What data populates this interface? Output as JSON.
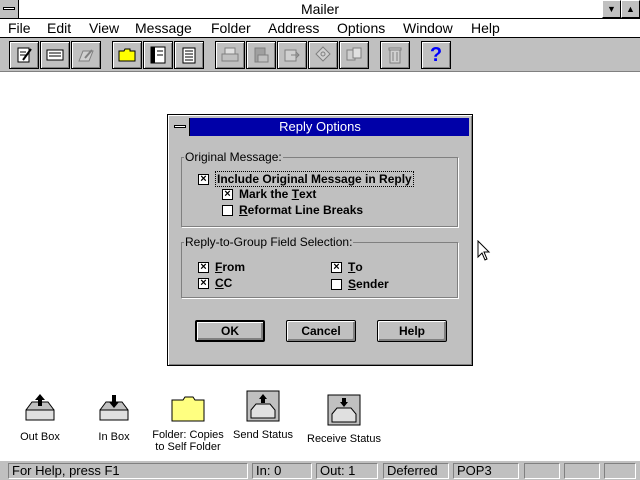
{
  "window": {
    "title": "Mailer",
    "min_glyph": "▼",
    "max_glyph": "▲"
  },
  "menu": [
    "File",
    "Edit",
    "View",
    "Message",
    "Folder",
    "Address",
    "Options",
    "Window",
    "Help"
  ],
  "toolbar": {
    "buttons": [
      "compose-icon",
      "reply-icon",
      "forward-icon",
      "open-folder-icon",
      "address-book-icon",
      "notepad-icon",
      "print-icon",
      "print-setup-icon",
      "move-icon",
      "attach-icon",
      "copy-icon",
      "delete-icon",
      "help-icon"
    ],
    "help_glyph": "?"
  },
  "dialog": {
    "title": "Reply Options",
    "original_group": "Original Message:",
    "include_original": {
      "label": "Include Original Message in Reply",
      "checked": true
    },
    "mark_text": {
      "label_pre": "Mark the ",
      "label_u": "T",
      "label_post": "ext",
      "checked": true
    },
    "reformat": {
      "label_u": "R",
      "label_post": "eformat Line Breaks",
      "checked": false
    },
    "group_field": "Reply-to-Group Field Selection:",
    "from": {
      "label_u": "F",
      "label_post": "rom",
      "checked": true
    },
    "to": {
      "label_u": "T",
      "label_post": "o",
      "checked": true
    },
    "cc": {
      "label_u": "C",
      "label_post": "C",
      "checked": true
    },
    "sender": {
      "label_u": "S",
      "label_post": "ender",
      "checked": false
    },
    "ok": "OK",
    "cancel": "Cancel",
    "help": "Help",
    "check_glyph": "×"
  },
  "desktop_icons": [
    {
      "label": "Out Box"
    },
    {
      "label": "In Box"
    },
    {
      "label1": "Folder: Copies",
      "label2": "to Self Folder"
    },
    {
      "label": "Send Status"
    },
    {
      "label": "Receive Status"
    }
  ],
  "status": {
    "help": "For Help, press F1",
    "in": "In:  0",
    "out": "Out:  1",
    "deferred": "Deferred",
    "protocol": "POP3"
  },
  "colors": {
    "accent": "#0000a8",
    "face": "#c0c0c0",
    "folder": "#ffff80"
  }
}
